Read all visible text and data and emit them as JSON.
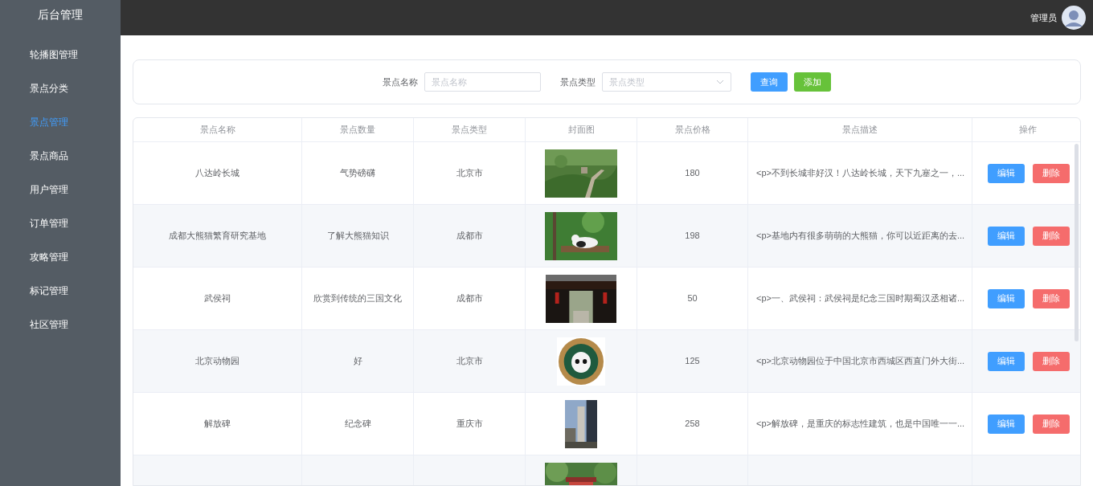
{
  "sidebar": {
    "title": "后台管理",
    "items": [
      {
        "label": "轮播图管理",
        "selected": false
      },
      {
        "label": "景点分类",
        "selected": false
      },
      {
        "label": "景点管理",
        "selected": true
      },
      {
        "label": "景点商品",
        "selected": false
      },
      {
        "label": "用户管理",
        "selected": false
      },
      {
        "label": "订单管理",
        "selected": false
      },
      {
        "label": "攻略管理",
        "selected": false
      },
      {
        "label": "标记管理",
        "selected": false
      },
      {
        "label": "社区管理",
        "selected": false
      }
    ]
  },
  "header": {
    "user": "管理员"
  },
  "search": {
    "name_label": "景点名称",
    "name_placeholder": "景点名称",
    "type_label": "景点类型",
    "type_placeholder": "景点类型",
    "query_button": "查询",
    "add_button": "添加"
  },
  "table": {
    "columns": [
      "景点名称",
      "景点数量",
      "景点类型",
      "封面图",
      "景点价格",
      "景点描述",
      "操作"
    ],
    "rows": [
      {
        "name": "八达岭长城",
        "count": "气势磅礴",
        "type": "北京市",
        "cover": {
          "kind": "picture"
        },
        "price": "180",
        "description": "<p>不到长城非好汉！八达岭长城，天下九塞之一，...",
        "edit": "编辑",
        "delete": "删除"
      },
      {
        "name": "成都大熊猫繁育研究基地",
        "count": "了解大熊猫知识",
        "type": "成都市",
        "cover": {
          "kind": "picture"
        },
        "price": "198",
        "description": "<p>基地内有很多萌萌的大熊猫，你可以近距离的去...",
        "edit": "编辑",
        "delete": "删除"
      },
      {
        "name": "武侯祠",
        "count": "欣赏到传统的三国文化",
        "type": "成都市",
        "cover": {
          "kind": "picture"
        },
        "price": "50",
        "description": "<p>一、武侯祠：武侯祠是纪念三国时期蜀汉丞相诸...",
        "edit": "编辑",
        "delete": "删除"
      },
      {
        "name": "北京动物园",
        "count": "好",
        "type": "北京市",
        "cover": {
          "kind": "picture"
        },
        "price": "125",
        "description": "<p>北京动物园位于中国北京市西城区西直门外大街...",
        "edit": "编辑",
        "delete": "删除"
      },
      {
        "name": "解放碑",
        "count": "纪念碑",
        "type": "重庆市",
        "cover": {
          "kind": "picture"
        },
        "price": "258",
        "description": "<p>解放碑，是重庆的标志性建筑，也是中国唯一一...",
        "edit": "编辑",
        "delete": "删除"
      },
      {
        "cover": {
          "kind": "picture"
        }
      }
    ]
  }
}
